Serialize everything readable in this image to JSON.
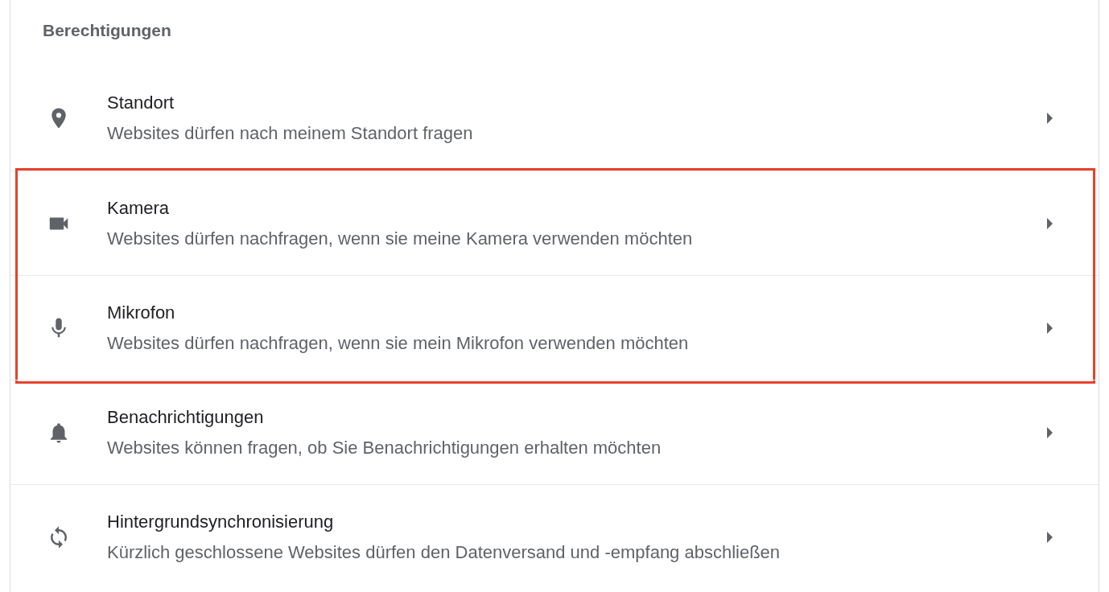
{
  "section_title": "Berechtigungen",
  "rows": [
    {
      "title": "Standort",
      "subtitle": "Websites dürfen nach meinem Standort fragen",
      "highlighted": false
    },
    {
      "title": "Kamera",
      "subtitle": "Websites dürfen nachfragen, wenn sie meine Kamera verwenden möchten",
      "highlighted": true
    },
    {
      "title": "Mikrofon",
      "subtitle": "Websites dürfen nachfragen, wenn sie mein Mikrofon verwenden möchten",
      "highlighted": true
    },
    {
      "title": "Benachrichtigungen",
      "subtitle": "Websites können fragen, ob Sie Benachrichtigungen erhalten möchten",
      "highlighted": false
    },
    {
      "title": "Hintergrundsynchronisierung",
      "subtitle": "Kürzlich geschlossene Websites dürfen den Datenversand und -empfang abschließen",
      "highlighted": false
    }
  ]
}
